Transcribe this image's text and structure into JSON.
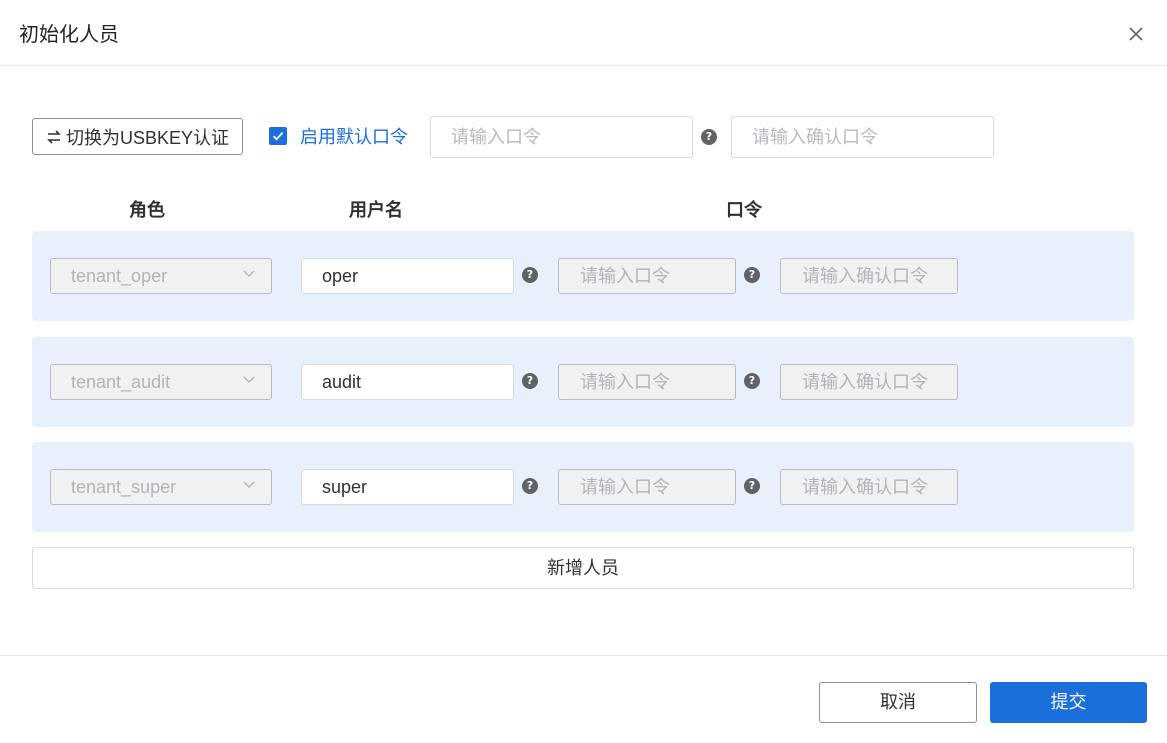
{
  "dialog": {
    "title": "初始化人员",
    "close_icon": "close-icon"
  },
  "toolbar": {
    "switch_label": "切换为USBKEY认证",
    "switch_icon": "swap-arrows-icon",
    "default_pwd_checked": true,
    "default_pwd_label": "启用默认口令",
    "pwd_placeholder": "请输入口令",
    "pwd_confirm_placeholder": "请输入确认口令"
  },
  "columns": {
    "role": "角色",
    "username": "用户名",
    "password": "口令"
  },
  "rows": [
    {
      "role": "tenant_oper",
      "username": "oper",
      "pwd_placeholder": "请输入口令",
      "confirm_placeholder": "请输入确认口令"
    },
    {
      "role": "tenant_audit",
      "username": "audit",
      "pwd_placeholder": "请输入口令",
      "confirm_placeholder": "请输入确认口令"
    },
    {
      "role": "tenant_super",
      "username": "super",
      "pwd_placeholder": "请输入口令",
      "confirm_placeholder": "请输入确认口令"
    }
  ],
  "add_member_label": "新增人员",
  "footer": {
    "cancel_label": "取消",
    "submit_label": "提交"
  },
  "colors": {
    "primary": "#1a6fdb",
    "row_background": "#e8f0fc"
  }
}
